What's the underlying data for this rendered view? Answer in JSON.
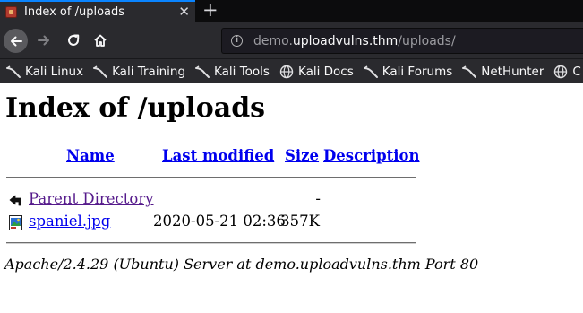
{
  "browser": {
    "tab": {
      "title": "Index of /uploads",
      "close_symbol": "✕",
      "favicon": "kali-favicon"
    },
    "new_tab_symbol": "+",
    "nav": {
      "back_icon": "back-arrow-icon",
      "forward_icon": "forward-arrow-icon",
      "reload_icon": "reload-icon",
      "home_icon": "home-icon"
    },
    "url": {
      "prefix": "demo.",
      "domain": "uploadvulns.thm",
      "path": "/uploads/"
    },
    "bookmarks": [
      {
        "label": "Kali Linux",
        "icon": "kali-dragon-icon"
      },
      {
        "label": "Kali Training",
        "icon": "kali-dragon-icon"
      },
      {
        "label": "Kali Tools",
        "icon": "kali-dragon-icon"
      },
      {
        "label": "Kali Docs",
        "icon": "globe-icon"
      },
      {
        "label": "Kali Forums",
        "icon": "kali-dragon-icon"
      },
      {
        "label": "NetHunter",
        "icon": "kali-dragon-icon"
      },
      {
        "label": "C",
        "icon": "globe-icon"
      }
    ],
    "colors": {
      "chrome_dark": "#0c0c0d",
      "toolbar": "#2a2a2e",
      "tab_accent": "#0a84ff"
    }
  },
  "page": {
    "heading": "Index of /uploads",
    "columns": {
      "name": "Name",
      "last_modified": "Last modified",
      "size": "Size",
      "description": "Description"
    },
    "rows": [
      {
        "name": "Parent Directory",
        "modified": "",
        "size": "-",
        "icon": "back-folder-icon",
        "visited": true
      },
      {
        "name": "spaniel.jpg",
        "modified": "2020-05-21 02:36",
        "size": "357K",
        "icon": "image-file-icon",
        "visited": false
      }
    ],
    "footer": "Apache/2.4.29 (Ubuntu) Server at demo.uploadvulns.thm Port 80",
    "colors": {
      "link": "#0000ee",
      "visited_link": "#551a8b"
    }
  }
}
